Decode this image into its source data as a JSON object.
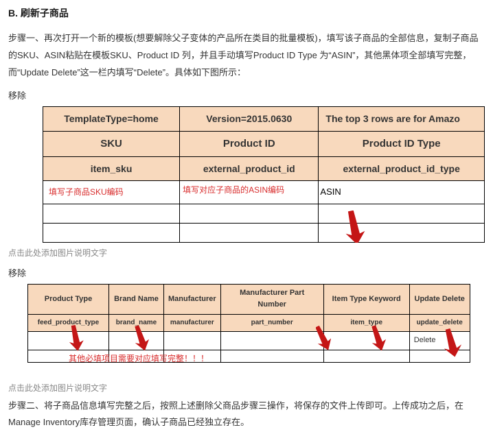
{
  "section_title": "B. 刷新子商品",
  "para1": "步骤一、再次打开一个新的模板(想要解除父子变体的产品所在类目的批量模板)，填写该子商品的全部信息，复制子商品的SKU、ASIN粘贴在模板SKU、Product ID 列，并且手动填写Product ID Type 为“ASIN”，其他黑体项全部填写完整，而“Update Delete”这一栏内填写“Delete”。具体如下图所示：",
  "remove": "移除",
  "table1": {
    "row1": [
      "TemplateType=home",
      "Version=2015.0630",
      "The top 3 rows are for Amazo"
    ],
    "row2": [
      "SKU",
      "Product ID",
      "Product ID Type"
    ],
    "row3": [
      "item_sku",
      "external_product_id",
      "external_product_id_type"
    ],
    "annot_left": "填写子商品SKU编码",
    "annot_mid": "填写对应子商品的ASIN编码",
    "row4_c3": "ASIN"
  },
  "caption1": "点击此处添加图片说明文字",
  "table2": {
    "row1": [
      "Product Type",
      "Brand Name",
      "Manufacturer",
      "Manufacturer Part Number",
      "Item Type Keyword",
      "Update Delete"
    ],
    "row2": [
      "feed_product_type",
      "brand_name",
      "manufacturer",
      "part_number",
      "item_type",
      "update_delete"
    ],
    "row3_c6": "Delete",
    "annot": "其他必填项目需要对应填写完整！！！"
  },
  "caption2": "点击此处添加图片说明文字",
  "para2": "步骤二、将子商品信息填写完整之后，按照上述删除父商品步骤三操作，将保存的文件上传即可。上传成功之后，在Manage Inventory库存管理页面，确认子商品已经独立存在。"
}
